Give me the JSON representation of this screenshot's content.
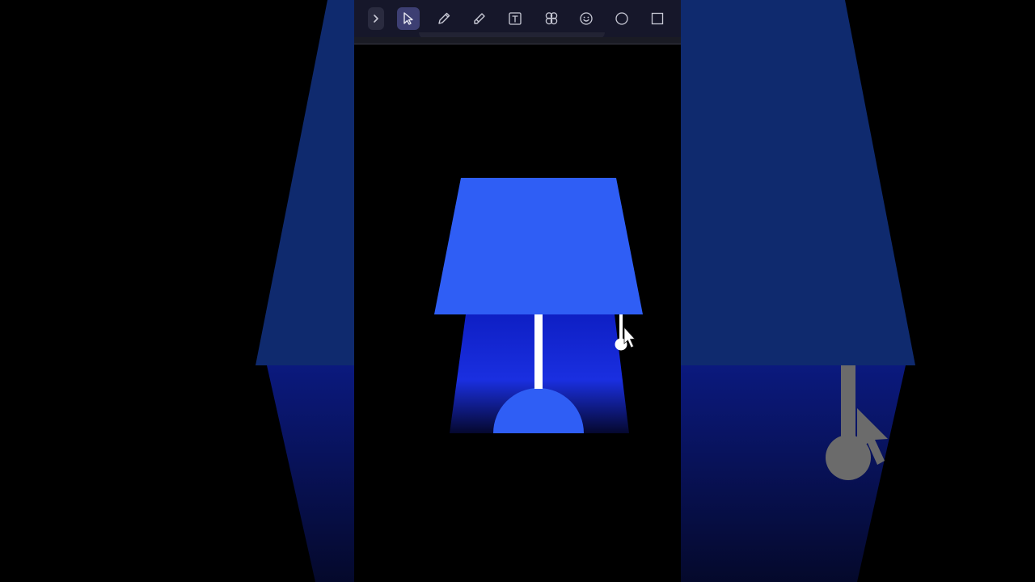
{
  "app": {
    "background": "#000000"
  },
  "toolbar": {
    "background": "#16172a",
    "active_tool": "select",
    "active_color": "#3d3f73",
    "tools": [
      {
        "id": "expand",
        "icon": "chevron-right-icon"
      },
      {
        "id": "select",
        "icon": "cursor-arrow-icon"
      },
      {
        "id": "pen",
        "icon": "pencil-icon"
      },
      {
        "id": "highlighter",
        "icon": "highlighter-icon"
      },
      {
        "id": "text",
        "icon": "text-box-icon"
      },
      {
        "id": "shapes",
        "icon": "shapes-icon"
      },
      {
        "id": "sticker",
        "icon": "smiley-icon"
      },
      {
        "id": "ellipse",
        "icon": "circle-icon"
      },
      {
        "id": "rectangle",
        "icon": "square-icon"
      }
    ]
  },
  "illustration": {
    "lamp_shade_color": "#2f5ef5",
    "light_beam_color": "#1a2fe0",
    "pole_color": "#ffffff",
    "base_color": "#2f5ef5",
    "pull_cord_color": "#ffffff"
  },
  "background_blur": {
    "shade_color": "#0f2a6e",
    "beam_color": "#0c1a8a",
    "cord_color": "#6b6b6b"
  }
}
